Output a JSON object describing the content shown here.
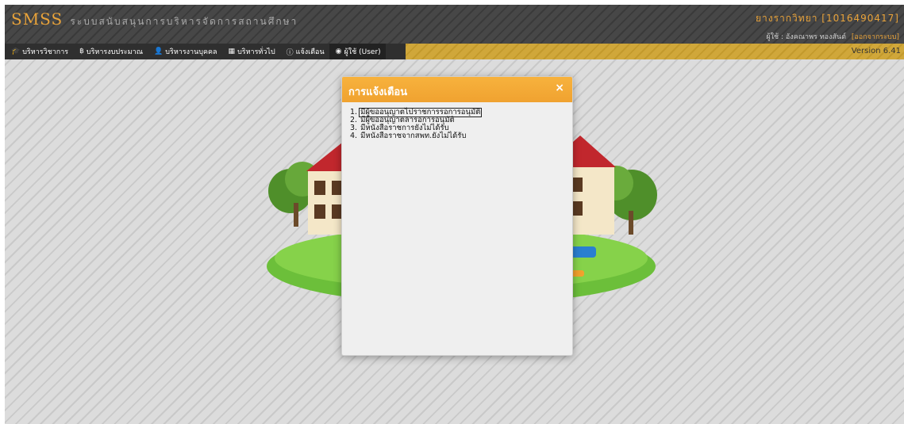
{
  "header": {
    "brand_abbr": "SMSS",
    "brand_full": "ระบบสนับสนุนการบริหารจัดการสถานศึกษา",
    "school": "ยางรากวิทยา [1016490417]",
    "user_line": "ผู้ใช้ : อังคณาพร ทองสันต์",
    "logout_label": "[ออกจากระบบ]"
  },
  "menu": {
    "items": [
      {
        "label": "บริหารวิชาการ",
        "icon": "graduation-cap-icon",
        "glyph": "🎓"
      },
      {
        "label": "บริหารงบประมาณ",
        "icon": "baht-icon",
        "glyph": "฿"
      },
      {
        "label": "บริหารงานบุคคล",
        "icon": "user-icon",
        "glyph": "👤"
      },
      {
        "label": "บริหารทั่วไป",
        "icon": "grid-icon",
        "glyph": "▦"
      },
      {
        "label": "แจ้งเตือน",
        "icon": "info-icon",
        "glyph": "ⓘ"
      },
      {
        "label": "ผู้ใช้ (User)",
        "icon": "user-circle-icon",
        "glyph": "◉"
      }
    ],
    "version": "Version 6.41"
  },
  "modal": {
    "title": "การแจ้งเตือน",
    "close": "×",
    "alerts": [
      {
        "num": "1.",
        "text": "มีผู้ขออนุญาตไปราชการรอการอนุมัติ"
      },
      {
        "num": "2.",
        "text": "มีผู้ขออนุญาตลารอการอนุมัติ"
      },
      {
        "num": "3.",
        "text": "มีหนังสือราชการยังไม่ได้รับ"
      },
      {
        "num": "4.",
        "text": "มีหนังสือราชจากสพท.ยังไม่ได้รับ"
      }
    ]
  },
  "colors": {
    "header_bg": "#3f3f3f",
    "accent_orange": "#f0a230",
    "menu_gold": "#c89f32"
  }
}
